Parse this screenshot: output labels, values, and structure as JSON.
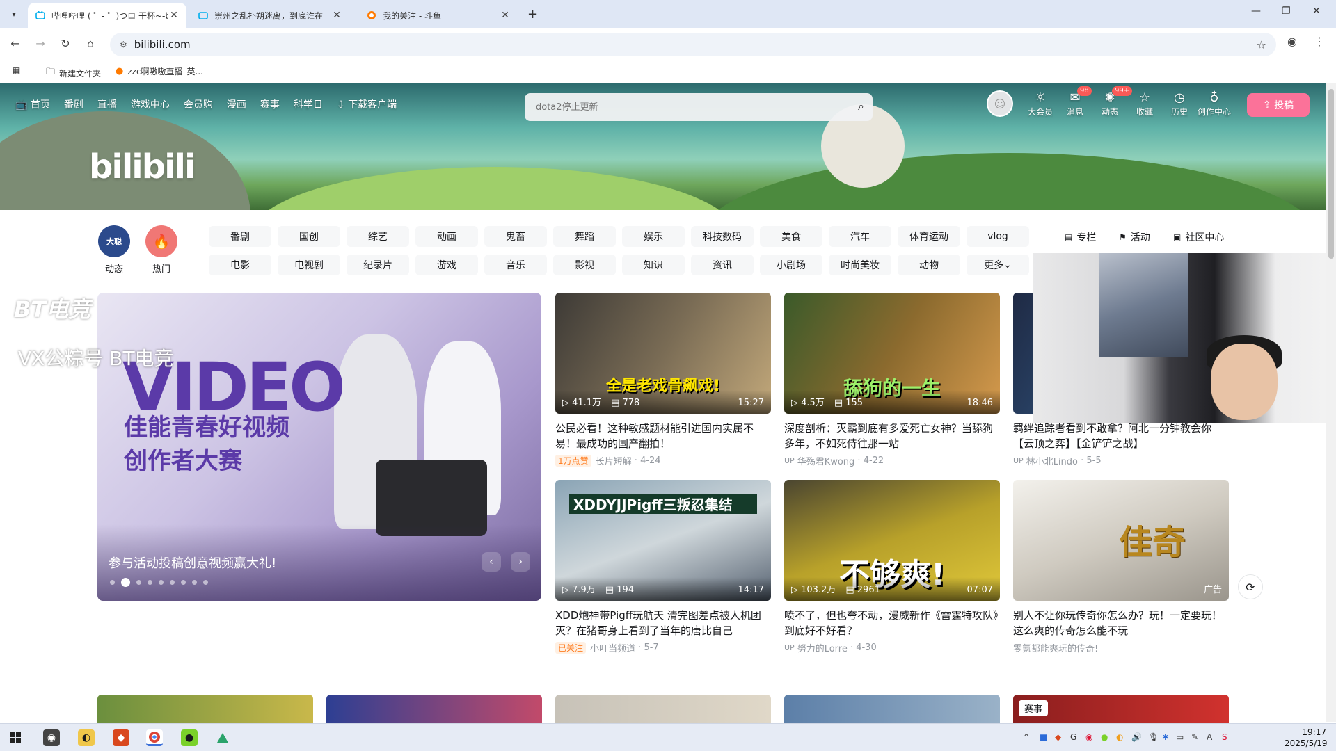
{
  "browser": {
    "tabs": [
      {
        "title": "哔哩哔哩 ( ゜- ゜)つロ 干杯~-bi",
        "active": true
      },
      {
        "title": "崇州之乱扑朔迷离，到底谁在",
        "active": false
      },
      {
        "title": "我的关注 - 斗鱼",
        "active": false
      }
    ],
    "url": "bilibili.com",
    "bookmarks": [
      "新建文件夹",
      "zzc啊嗷嗷直播_英..."
    ]
  },
  "header": {
    "nav": [
      "首页",
      "番剧",
      "直播",
      "游戏中心",
      "会员购",
      "漫画",
      "赛事",
      "科学日",
      "下载客户端"
    ],
    "logo": "bilibili",
    "search_placeholder": "dota2停止更新",
    "right_items": [
      {
        "label": "大会员",
        "icon": "vip-icon",
        "badge": ""
      },
      {
        "label": "消息",
        "icon": "message-icon",
        "badge": "98"
      },
      {
        "label": "动态",
        "icon": "dynamic-icon",
        "badge": "99+"
      },
      {
        "label": "收藏",
        "icon": "star-icon",
        "badge": ""
      },
      {
        "label": "历史",
        "icon": "clock-icon",
        "badge": ""
      },
      {
        "label": "创作中心",
        "icon": "lightbulb-icon",
        "badge": ""
      }
    ],
    "upload_label": "投稿"
  },
  "channels": {
    "feed_label": "动态",
    "hot_label": "热门",
    "row1": [
      "番剧",
      "国创",
      "综艺",
      "动画",
      "鬼畜",
      "舞蹈",
      "娱乐",
      "科技数码",
      "美食",
      "汽车",
      "体育运动",
      "vlog"
    ],
    "row2": [
      "电影",
      "电视剧",
      "纪录片",
      "游戏",
      "音乐",
      "影视",
      "知识",
      "资讯",
      "小剧场",
      "时尚美妆",
      "动物",
      "更多"
    ],
    "side": [
      "专栏",
      "活动",
      "社区中心"
    ]
  },
  "carousel": {
    "headline": "VIDEO",
    "subline": "佳能青春好视频\n创作者大赛",
    "caption": "参与活动投稿创意视频赢大礼!",
    "dot_count": 9,
    "active_dot": 1
  },
  "overlay": {
    "watermark": "BT电竞",
    "wechat": "VX公粽号 BT电竞"
  },
  "videos": [
    {
      "title": "公民必看！这种敏感题材能引进国内实属不易！最成功的国产翻拍！",
      "plays": "41.1万",
      "danmaku": "778",
      "duration": "15:27",
      "tag": "1万点赞",
      "author": "长片短解",
      "date": "4-24",
      "overlay_text": "全是老戏骨飙戏!"
    },
    {
      "title": "深度剖析：灭霸到底有多爱死亡女神？当舔狗多年，不如死侍往那一站",
      "plays": "4.5万",
      "danmaku": "155",
      "duration": "18:46",
      "tag": "",
      "author": "华殇君Kwong",
      "date": "4-22",
      "overlay_text": "舔狗的一生"
    },
    {
      "title": "羁绊追踪者看到不敢拿？阿北一分钟教会你【云顶之弈】【金铲铲之战】",
      "plays": "",
      "danmaku": "",
      "duration": "",
      "tag": "",
      "author": "林小北Lindo",
      "date": "5-5",
      "overlay_text": ""
    },
    {
      "title": "XDD炮神带Pigff玩航天 清完图差点被人机团灭？在猪哥身上看到了当年的唐比自己",
      "plays": "7.9万",
      "danmaku": "194",
      "duration": "14:17",
      "tag": "已关注",
      "author": "小叮当频道",
      "date": "5-7",
      "overlay_text": "XDDYJJPigff三叛忍集结"
    },
    {
      "title": "喷不了，但也夸不动，漫威新作《雷霆特攻队》到底好不好看？",
      "plays": "103.2万",
      "danmaku": "2961",
      "duration": "07:07",
      "tag": "",
      "author": "努力的Lorre",
      "date": "4-30",
      "overlay_text": "不够爽!"
    },
    {
      "title": "别人不让你玩传奇你怎么办？玩！一定要玩！这么爽的传奇怎么能不玩",
      "plays": "",
      "danmaku": "",
      "duration": "",
      "tag": "",
      "author": "零氪都能爽玩的传奇!",
      "date": "",
      "overlay_text": "佳奇",
      "ad": "广告"
    }
  ],
  "bottom_row_badge": "赛事",
  "taskbar": {
    "time": "19:17",
    "date": "2025/5/19"
  },
  "colors": {
    "brand_pink": "#fb7299",
    "badge_red": "#fa5a57",
    "tag_orange": "#ff7f24"
  }
}
